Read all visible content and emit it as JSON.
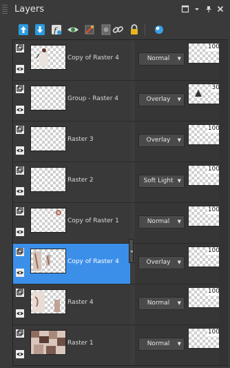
{
  "panel": {
    "title": "Layers"
  },
  "titlebar_buttons": [
    {
      "name": "float-icon",
      "glyph": "□"
    },
    {
      "name": "chevron-down-icon",
      "glyph": "▾"
    },
    {
      "name": "pin-icon",
      "glyph": "⊥"
    },
    {
      "name": "close-icon",
      "glyph": "✕"
    }
  ],
  "toolbar": [
    {
      "name": "new-raster-layer-icon"
    },
    {
      "name": "new-vector-layer-icon"
    },
    {
      "name": "adjustment-layer-icon"
    },
    {
      "name": "visibility-icon"
    },
    {
      "name": "delete-layer-icon"
    },
    {
      "name": "mask-icon"
    },
    {
      "name": "link-icon"
    },
    {
      "name": "lock-icon"
    },
    {
      "name": "effects-icon"
    }
  ],
  "layers": [
    {
      "name": "Copy of Raster 4",
      "blend": "Normal",
      "opacity": "100",
      "selected": false,
      "thumb": "figure"
    },
    {
      "name": "Group - Raster 4",
      "blend": "Overlay",
      "opacity": "30",
      "selected": false,
      "thumb": "empty"
    },
    {
      "name": "Raster 3",
      "blend": "Overlay",
      "opacity": "100",
      "selected": false,
      "thumb": "faint"
    },
    {
      "name": "Raster 2",
      "blend": "Soft Light",
      "opacity": "100",
      "selected": false,
      "thumb": "empty"
    },
    {
      "name": "Copy of Raster 1",
      "blend": "Normal",
      "opacity": "100",
      "selected": false,
      "thumb": "dot"
    },
    {
      "name": "Copy of Raster 4",
      "blend": "Overlay",
      "opacity": "100",
      "selected": true,
      "thumb": "collage"
    },
    {
      "name": "Raster 4",
      "blend": "Normal",
      "opacity": "100",
      "selected": false,
      "thumb": "collage2"
    },
    {
      "name": "Raster 1",
      "blend": "Normal",
      "opacity": "100",
      "selected": false,
      "thumb": "tiles"
    }
  ],
  "colors": {
    "selection": "#3b8fe9",
    "panel": "#3a3a3a"
  }
}
